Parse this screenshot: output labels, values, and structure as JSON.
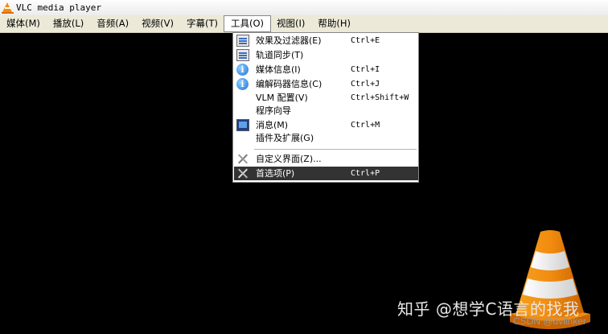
{
  "window": {
    "title": "VLC media player"
  },
  "menubar": {
    "items": [
      {
        "label": "媒体(M)"
      },
      {
        "label": "播放(L)"
      },
      {
        "label": "音频(A)"
      },
      {
        "label": "视频(V)"
      },
      {
        "label": "字幕(T)"
      },
      {
        "label": "工具(O)",
        "active": true
      },
      {
        "label": "视图(I)"
      },
      {
        "label": "帮助(H)"
      }
    ]
  },
  "tools_menu": {
    "items": [
      {
        "label": "效果及过滤器(E)",
        "shortcut": "Ctrl+E",
        "icon": "equalizer-icon"
      },
      {
        "label": "轨道同步(T)",
        "shortcut": "",
        "icon": "equalizer-icon"
      },
      {
        "label": "媒体信息(I)",
        "shortcut": "Ctrl+I",
        "icon": "info-icon"
      },
      {
        "label": "编解码器信息(C)",
        "shortcut": "Ctrl+J",
        "icon": "info-icon"
      },
      {
        "label": "VLM 配置(V)",
        "shortcut": "Ctrl+Shift+W",
        "icon": ""
      },
      {
        "label": "程序向导",
        "shortcut": "",
        "icon": ""
      },
      {
        "label": "消息(M)",
        "shortcut": "Ctrl+M",
        "icon": "terminal-icon"
      },
      {
        "label": "插件及扩展(G)",
        "shortcut": "",
        "icon": ""
      },
      {
        "label": "自定义界面(Z)...",
        "shortcut": "",
        "icon": "tools-icon"
      },
      {
        "label": "首选项(P)",
        "shortcut": "Ctrl+P",
        "icon": "tools-icon",
        "selected": true
      }
    ]
  },
  "overlay": {
    "watermark": "知乎 @想学C语言的找我",
    "csdn": "CSDN @dvlinker"
  },
  "colors": {
    "menubar_bg": "#ece9d8",
    "selection_bg": "#333333",
    "video_bg": "#000000",
    "cone_orange": "#f28c10"
  }
}
